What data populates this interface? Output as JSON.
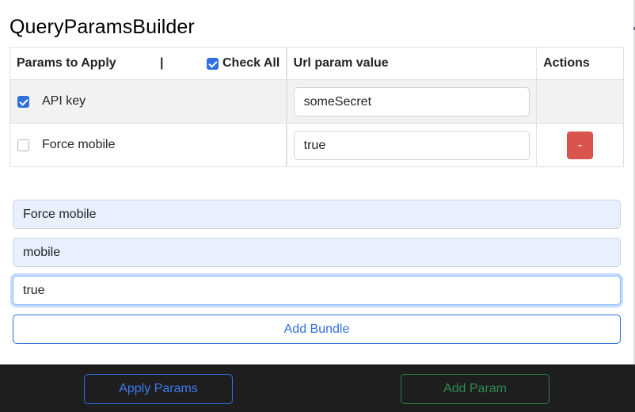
{
  "title": "QueryParamsBuilder",
  "table": {
    "headers": {
      "params": "Params to Apply",
      "separator": "|",
      "check_all": "Check All",
      "url_value": "Url param value",
      "actions": "Actions"
    },
    "check_all_checked": true,
    "rows": [
      {
        "label": "API key",
        "checked": true,
        "value": "someSecret",
        "has_remove": false
      },
      {
        "label": "Force mobile",
        "checked": false,
        "value": "true",
        "has_remove": true,
        "remove_label": "-"
      }
    ]
  },
  "bundle_form": {
    "name_value": "Force mobile",
    "key_value": "mobile",
    "value_value": "true",
    "add_bundle_label": "Add Bundle"
  },
  "footer": {
    "apply_label": "Apply Params",
    "add_param_label": "Add Param"
  },
  "colors": {
    "primary": "#2f6fe0",
    "danger": "#d9534f",
    "success": "#2e7d46",
    "footer_bg": "#1e1e1e",
    "autofill_bg": "#e8f0fe"
  }
}
